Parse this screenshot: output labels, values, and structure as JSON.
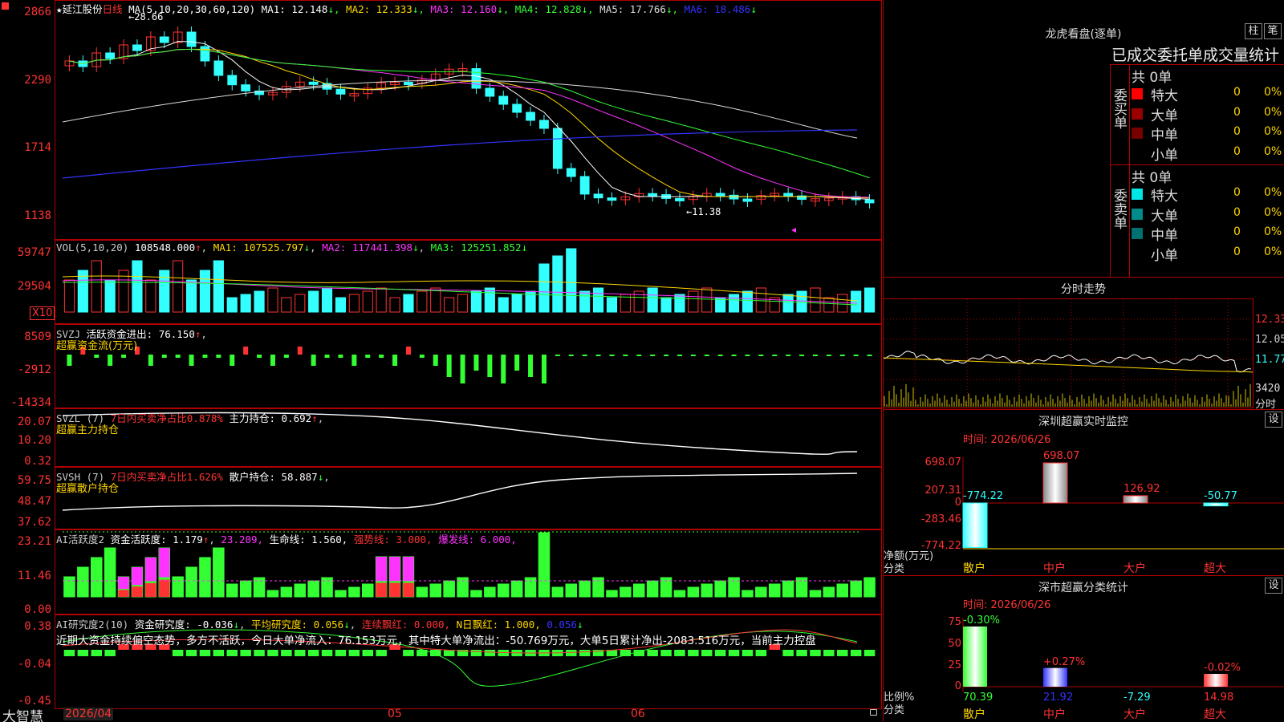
{
  "stock": {
    "name": "延江股份",
    "period": "日线",
    "ma_header": "MA(5,10,20,30,60,120)",
    "ma_values": [
      {
        "label": "MA1: 12.148",
        "arrow": "↓",
        "color": "#ffffff"
      },
      {
        "label": "MA2: 12.333",
        "arrow": "↓",
        "color": "#ffd700"
      },
      {
        "label": "MA3: 12.160",
        "arrow": "↓",
        "color": "#ff33ff"
      },
      {
        "label": "MA4: 12.828",
        "arrow": "↓",
        "color": "#33ff33"
      },
      {
        "label": "MA5: 17.766",
        "arrow": "↓",
        "color": "#dddddd"
      },
      {
        "label": "MA6: 18.486",
        "arrow": "↓",
        "color": "#3333ff"
      }
    ],
    "high_marker": "28.66",
    "low_marker": "11.38",
    "price_axis": [
      "2866",
      "2290",
      "1714",
      "1138"
    ]
  },
  "vol": {
    "header": "VOL(5,10,20)",
    "value": "108548.000",
    "ma1": "MA1: 107525.797",
    "ma2": "MA2: 117441.398",
    "ma3": "MA3: 125251.852",
    "axis": [
      "59747",
      "29504"
    ],
    "unit": "X10"
  },
  "svzj": {
    "header": "SVZJ",
    "label": "活跃资金进出: 76.150",
    "sub": "超赢资金流(万元)",
    "axis": [
      "8509",
      "-2912",
      "-14334"
    ]
  },
  "svzl": {
    "header": "SVZL (7)",
    "label1": "7日内买卖净占比0.878%",
    "label2": "主力持仓: 0.692",
    "sub": "超赢主力持仓",
    "axis": [
      "20.07",
      "10.20",
      "0.32"
    ]
  },
  "svsh": {
    "header": "SVSH (7)",
    "label1": "7日内买卖净占比1.626%",
    "label2": "散户持仓: 58.887",
    "sub": "超赢散户持仓",
    "axis": [
      "59.75",
      "48.47",
      "37.62"
    ]
  },
  "ai1": {
    "header": "AI活跃度2",
    "v1": "资金活跃度: 1.179",
    "v2": "23.209,",
    "v3": "生命线: 1.560,",
    "v4": "强势线: 3.000,",
    "v5": "爆发线: 6.000,",
    "axis": [
      "23.21",
      "11.46",
      "0.00"
    ]
  },
  "ai2": {
    "header": "AI研究度2(10)",
    "v1": "资金研究度: -0.036",
    "v2": "平均研究度: 0.056",
    "v3": "连续飘红: 0.000,",
    "v4": "N日飘红: 1.000,",
    "v5": "0.056",
    "desc": "近期大资金持续偏空态势，多方不活跃，今日大单净流入：76.153万元，其中特大单净流出：-50.769万元，大单5日累计净出-2083.516万元，当前主力控盘",
    "axis": [
      "0.38",
      "-0.04",
      "-0.45"
    ]
  },
  "bottom": {
    "brand": "大智慧",
    "dates": [
      "2026/04",
      "05",
      "06"
    ]
  },
  "dragon": {
    "title": "龙虎看盘(逐单)",
    "btn1": "柱",
    "btn2": "笔",
    "tabs": "已成交委托单成交量统计",
    "buy_label": "委买单",
    "sell_label": "委卖单",
    "buy_total": "共 0单",
    "sell_total": "共 0单",
    "buy_rows": [
      {
        "name": "特大",
        "count": "0",
        "pct": "0%",
        "color": "#ff0000"
      },
      {
        "name": "大单",
        "count": "0",
        "pct": "0%",
        "color": "#990000"
      },
      {
        "name": "中单",
        "count": "0",
        "pct": "0%",
        "color": "#770000"
      },
      {
        "name": "小单",
        "count": "0",
        "pct": "0%",
        "color": "#000000"
      }
    ],
    "sell_rows": [
      {
        "name": "特大",
        "count": "0",
        "pct": "0%",
        "color": "#00e5e5"
      },
      {
        "name": "大单",
        "count": "0",
        "pct": "0%",
        "color": "#008b8b"
      },
      {
        "name": "中单",
        "count": "0",
        "pct": "0%",
        "color": "#007070"
      },
      {
        "name": "小单",
        "count": "0",
        "pct": "0%",
        "color": "#000000"
      }
    ]
  },
  "intraday": {
    "title": "分时走势",
    "axis": [
      "12.33",
      "12.05",
      "11.77",
      "3420"
    ],
    "label": "分时"
  },
  "monitor": {
    "title": "深圳超赢实时监控",
    "set": "设",
    "time": "时间: 2026/06/26",
    "axis": [
      "698.07",
      "207.31",
      "0",
      "-283.46",
      "-774.22"
    ],
    "ylabel1": "净额(万元)",
    "ylabel2": "分类",
    "bars": [
      {
        "name": "散户",
        "value": -774.22,
        "label": "-774.22"
      },
      {
        "name": "中户",
        "value": 698.07,
        "label": "698.07"
      },
      {
        "name": "大户",
        "value": 126.92,
        "label": "126.92"
      },
      {
        "name": "超大",
        "value": -50.77,
        "label": "-50.77"
      }
    ]
  },
  "classify": {
    "title": "深市超赢分类统计",
    "set": "设",
    "time": "时间: 2026/06/26",
    "axis": [
      "75",
      "50",
      "25",
      "0"
    ],
    "ylabel1": "比例%",
    "ylabel2": "分类",
    "bars": [
      {
        "name": "散户",
        "value": 70.39,
        "pct": "-0.30%",
        "bottom": "70.39"
      },
      {
        "name": "中户",
        "value": 21.92,
        "pct": "+0.27%",
        "bottom": "21.92"
      },
      {
        "name": "大户",
        "value": -7.29,
        "pct": "",
        "bottom": "-7.29"
      },
      {
        "name": "超大",
        "value": 14.98,
        "pct": "-0.02%",
        "bottom": "14.98"
      }
    ]
  }
}
